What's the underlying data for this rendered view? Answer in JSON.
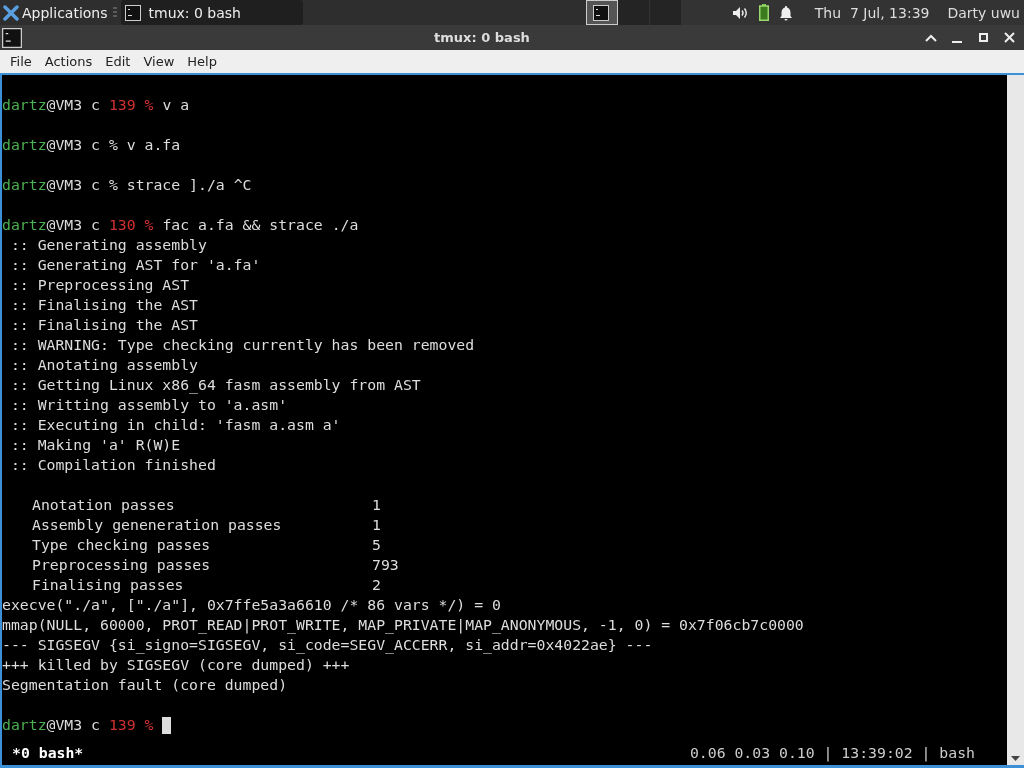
{
  "panel": {
    "apps_menu": "Applications",
    "tasks": [
      {
        "title": "tmux: 0 bash",
        "selected": true
      }
    ],
    "workspaces": [
      {
        "selected": true
      },
      {
        "selected": false
      },
      {
        "selected": false
      }
    ],
    "clock": "Thu  7 Jul, 13:39",
    "user": "Darty uwu"
  },
  "window": {
    "title": "tmux: 0 bash"
  },
  "menu": [
    "File",
    "Actions",
    "Edit",
    "View",
    "Help"
  ],
  "terminal": {
    "lines": [
      {
        "kind": "prompt",
        "user": "dartz",
        "host": "@VM3 c",
        "exit_code": "139",
        "sign": "%",
        "command": "v a"
      },
      {
        "kind": "blank"
      },
      {
        "kind": "prompt",
        "user": "dartz",
        "host": "@VM3 c",
        "sign": "%",
        "command": "v a.fa"
      },
      {
        "kind": "blank"
      },
      {
        "kind": "prompt",
        "user": "dartz",
        "host": "@VM3 c",
        "sign": "%",
        "command": "strace ]./a ^C"
      },
      {
        "kind": "blank"
      },
      {
        "kind": "prompt",
        "user": "dartz",
        "host": "@VM3 c",
        "exit_code": "130",
        "sign": "%",
        "command": "fac a.fa && strace ./a"
      },
      {
        "kind": "output",
        "text": " :: Generating assembly"
      },
      {
        "kind": "output",
        "text": " :: Generating AST for 'a.fa'"
      },
      {
        "kind": "output",
        "text": " :: Preprocessing AST"
      },
      {
        "kind": "output",
        "text": " :: Finalising the AST"
      },
      {
        "kind": "output",
        "text": " :: Finalising the AST"
      },
      {
        "kind": "output",
        "text": " :: WARNING: Type checking currently has been removed"
      },
      {
        "kind": "output",
        "text": " :: Anotating assembly"
      },
      {
        "kind": "output",
        "text": " :: Getting Linux x86_64 fasm assembly from AST"
      },
      {
        "kind": "output",
        "text": " :: Writting assembly to 'a.asm'"
      },
      {
        "kind": "output",
        "text": " :: Executing in child: 'fasm a.asm a'"
      },
      {
        "kind": "output",
        "text": " :: Making 'a' R(W)E"
      },
      {
        "kind": "output",
        "text": " :: Compilation finished"
      },
      {
        "kind": "blank"
      },
      {
        "kind": "stat",
        "label": "Anotation passes",
        "value": "1"
      },
      {
        "kind": "stat",
        "label": "Assembly geneneration passes",
        "value": "1"
      },
      {
        "kind": "stat",
        "label": "Type checking passes",
        "value": "5"
      },
      {
        "kind": "stat",
        "label": "Preprocessing passes",
        "value": "793"
      },
      {
        "kind": "stat",
        "label": "Finalising passes",
        "value": "2"
      },
      {
        "kind": "output",
        "text": "execve(\"./a\", [\"./a\"], 0x7ffe5a3a6610 /* 86 vars */) = 0"
      },
      {
        "kind": "output",
        "text": "mmap(NULL, 60000, PROT_READ|PROT_WRITE, MAP_PRIVATE|MAP_ANONYMOUS, -1, 0) = 0x7f06cb7c0000"
      },
      {
        "kind": "output",
        "text": "--- SIGSEGV {si_signo=SIGSEGV, si_code=SEGV_ACCERR, si_addr=0x4022ae} ---"
      },
      {
        "kind": "output",
        "text": "+++ killed by SIGSEGV (core dumped) +++"
      },
      {
        "kind": "output",
        "text": "Segmentation fault (core dumped)"
      },
      {
        "kind": "blank"
      },
      {
        "kind": "prompt",
        "user": "dartz",
        "host": "@VM3 c",
        "exit_code": "139",
        "sign": "%",
        "cursor": true
      }
    ],
    "status_left": "*0 bash*",
    "status_right": "0.06 0.03 0.10 | 13:39:02 | bash"
  }
}
